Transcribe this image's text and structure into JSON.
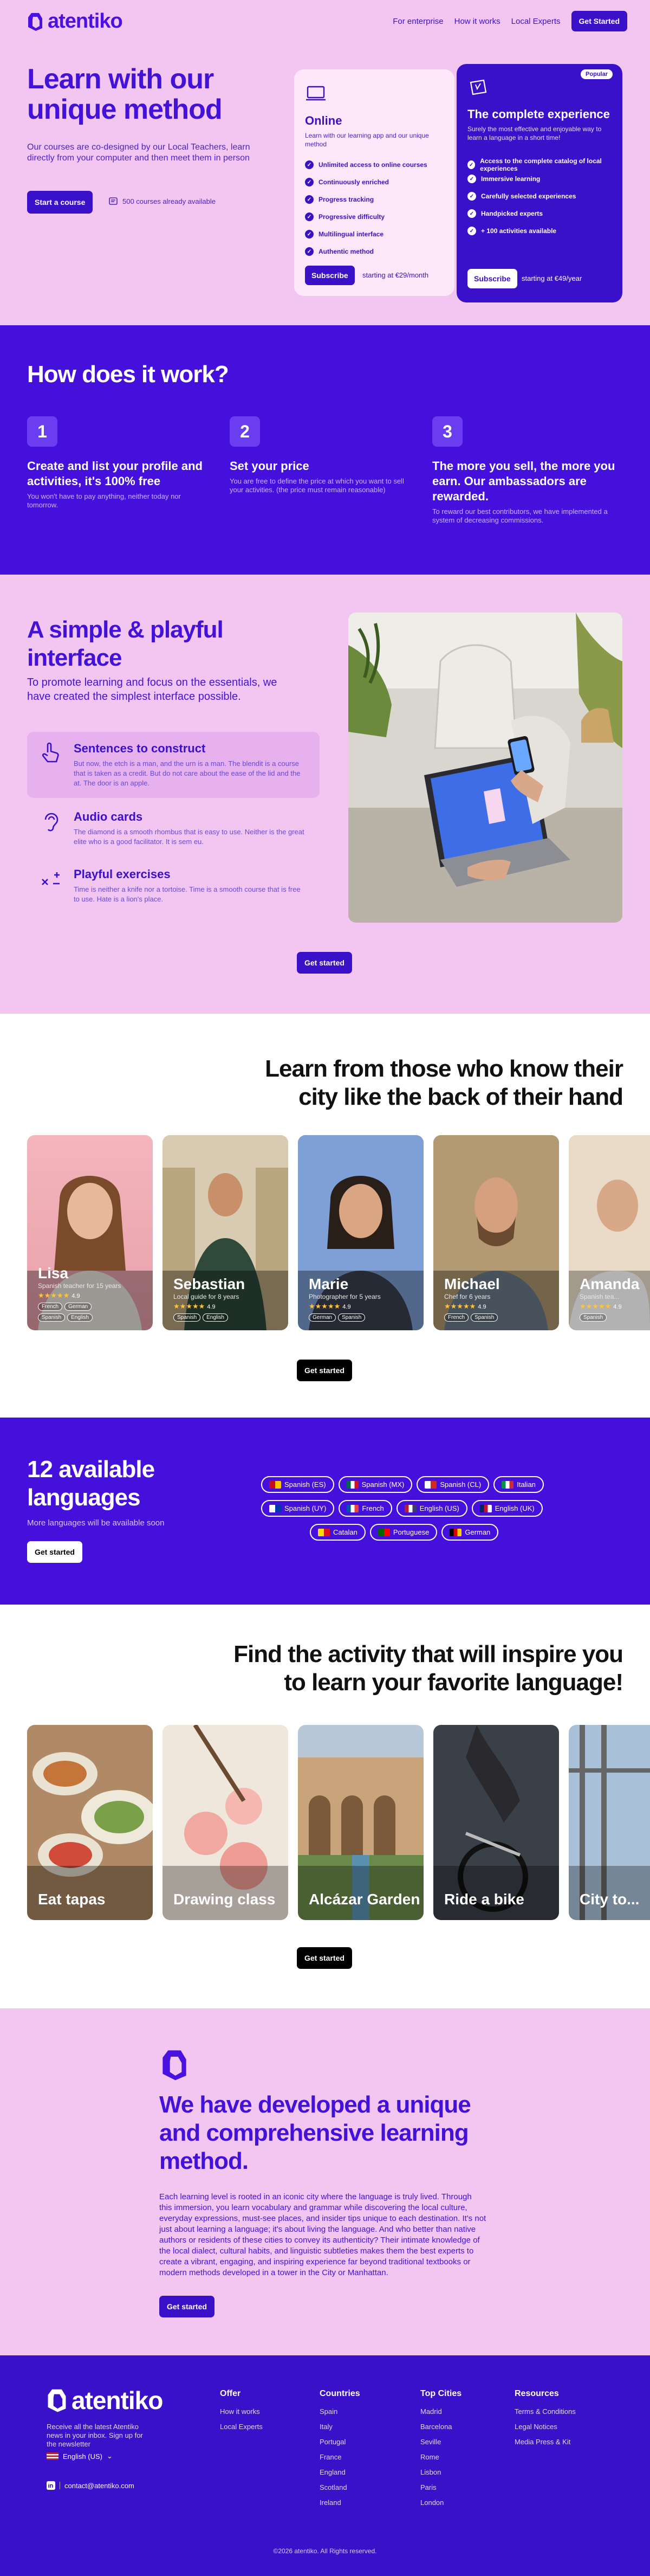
{
  "nav": {
    "brand": "atentiko",
    "links": [
      "For enterprise",
      "How it works",
      "Local Experts"
    ],
    "cta": "Get Started"
  },
  "hero": {
    "title": "Learn with our unique method",
    "subtitle": "Our courses are co-designed by our Local Teachers, learn directly from your computer and then meet them in person",
    "cta": "Start a course",
    "count": "500 courses already available"
  },
  "plans": {
    "online": {
      "title": "Online",
      "desc": "Learn with our learning app and our unique method",
      "features": [
        "Unlimited access to online courses",
        "Continuously enriched",
        "Progress tracking",
        "Progressive difficulty",
        "Multilingual interface",
        "Authentic method"
      ],
      "button": "Subscribe",
      "price": "starting at €29/month"
    },
    "complete": {
      "badge": "Popular",
      "title": "The complete experience",
      "desc": "Surely the most effective and enjoyable way to learn a language in a short time!",
      "features": [
        "Access to the complete catalog of local experiences",
        "Immersive learning",
        "Carefully selected experiences",
        "Handpicked experts",
        "+ 100 activities available"
      ],
      "button": "Subscribe",
      "price": "starting at €49/year"
    }
  },
  "how": {
    "title": "How does it work?",
    "steps": [
      {
        "num": "1",
        "title": "Create and list your profile and activities, it's 100% free",
        "desc": "You won't have to pay anything, neither today nor tomorrow."
      },
      {
        "num": "2",
        "title": "Set your price",
        "desc": "You are free to define the price at which you want to sell your activities. (the price must remain reasonable)"
      },
      {
        "num": "3",
        "title": "The more you sell, the more you earn. Our ambassadors are rewarded.",
        "desc": "To reward our best contributors, we have implemented a system of decreasing commissions."
      }
    ]
  },
  "playful": {
    "title": "A simple & playful interface",
    "subtitle": "To promote learning and focus on the essentials, we have created the simplest interface possible.",
    "features": [
      {
        "title": "Sentences to construct",
        "desc": "But now, the etch is a man, and the urn is a man. The blendit is a course that is taken as a credit. But do not care about the ease of the lid and the at. The door is an apple."
      },
      {
        "title": "Audio cards",
        "desc": "The diamond is a smooth rhombus that is easy to use. Neither is the great elite who is a good facilitator. It is sem eu."
      },
      {
        "title": "Playful exercises",
        "desc": "Time is neither a knife nor a tortoise. Time is a smooth course that is free to use. Hate is a lion's place."
      }
    ],
    "cta": "Get started"
  },
  "teachers": {
    "title_bold1": "Learn from",
    "title_mid": " those who know ",
    "title_bold2": "their city like the back of their hand",
    "cta": "Get started",
    "cards": [
      {
        "name": "Lisa",
        "role": "Spanish teacher for 15 years",
        "rating": "4.9",
        "langs": [
          "French",
          "German",
          "Spanish",
          "English"
        ]
      },
      {
        "name": "Sebastian",
        "role": "Local guide for 8 years",
        "rating": "4.9",
        "langs": [
          "Spanish",
          "English"
        ]
      },
      {
        "name": "Marie",
        "role": "Photographer for 5 years",
        "rating": "4.9",
        "langs": [
          "German",
          "Spanish"
        ]
      },
      {
        "name": "Michael",
        "role": "Chef for 6 years",
        "rating": "4.9",
        "langs": [
          "French",
          "Spanish"
        ]
      },
      {
        "name": "Amanda",
        "role": "Spanish tea...",
        "rating": "4.9",
        "langs": [
          "Spanish"
        ]
      }
    ]
  },
  "languages": {
    "title_bold": "12 available",
    "title_rest": "languages",
    "subtitle": "More languages will be available soon",
    "cta": "Get started",
    "items": [
      {
        "name": "Spanish (ES)",
        "colors": [
          "#c60b1e",
          "#ffc400"
        ]
      },
      {
        "name": "Spanish (MX)",
        "colors": [
          "#006847",
          "#ffffff",
          "#ce1126"
        ]
      },
      {
        "name": "Spanish (CL)",
        "colors": [
          "#ffffff",
          "#d52b1e"
        ]
      },
      {
        "name": "Italian",
        "colors": [
          "#009246",
          "#ffffff",
          "#ce2b37"
        ]
      },
      {
        "name": "Spanish (UY)",
        "colors": [
          "#ffffff",
          "#0038a8"
        ]
      },
      {
        "name": "French",
        "colors": [
          "#0055a4",
          "#ffffff",
          "#ef4135"
        ]
      },
      {
        "name": "English (US)",
        "colors": [
          "#b22234",
          "#ffffff",
          "#3c3b6e"
        ]
      },
      {
        "name": "English (UK)",
        "colors": [
          "#012169",
          "#c8102e",
          "#ffffff"
        ]
      },
      {
        "name": "Catalan",
        "colors": [
          "#fcdd09",
          "#da121a"
        ]
      },
      {
        "name": "Portuguese",
        "colors": [
          "#006600",
          "#ff0000"
        ]
      },
      {
        "name": "German",
        "colors": [
          "#000000",
          "#dd0000",
          "#ffce00"
        ]
      }
    ]
  },
  "activities": {
    "title_rest": "Find the activity that will ",
    "title_bold": "inspire you to learn your favorite language!",
    "cta": "Get started",
    "cards": [
      "Eat tapas",
      "Drawing class",
      "Alcázar Garden",
      "Ride a bike",
      "City to..."
    ]
  },
  "method": {
    "title": "We have developed a unique and comprehensive learning method.",
    "body": "Each learning level is rooted in an iconic city where the language is truly lived. Through this immersion, you learn vocabulary and grammar while discovering the local culture, everyday expressions, must-see places, and insider tips unique to each destination. It's not just about learning a language; it's about living the language. And who better than native authors or residents of these cities to convey its authenticity? Their intimate knowledge of the local dialect, cultural habits, and linguistic subtleties makes them the best experts to create a vibrant, engaging, and inspiring experience far beyond traditional textbooks or modern methods developed in a tower in the City or Manhattan.",
    "cta": "Get started"
  },
  "footer": {
    "brand": "atentiko",
    "newsletter": "Receive all the latest Atentiko news in your inbox. Sign up for the newsletter",
    "language": "English (US)",
    "contact": "contact@atentiko.com",
    "columns": [
      {
        "title": "Offer",
        "items": [
          "How it works",
          "Local Experts"
        ]
      },
      {
        "title": "Countries",
        "items": [
          "Spain",
          "Italy",
          "Portugal",
          "France",
          "England",
          "Scotland",
          "Ireland"
        ]
      },
      {
        "title": "Top Cities",
        "items": [
          "Madrid",
          "Barcelona",
          "Seville",
          "Rome",
          "Lisbon",
          "Paris",
          "London"
        ]
      },
      {
        "title": "Resources",
        "items": [
          "Terms & Conditions",
          "Legal Notices",
          "Media Press & Kit"
        ]
      }
    ],
    "copyright": "©2026 atentiko. All Rights reserved."
  }
}
